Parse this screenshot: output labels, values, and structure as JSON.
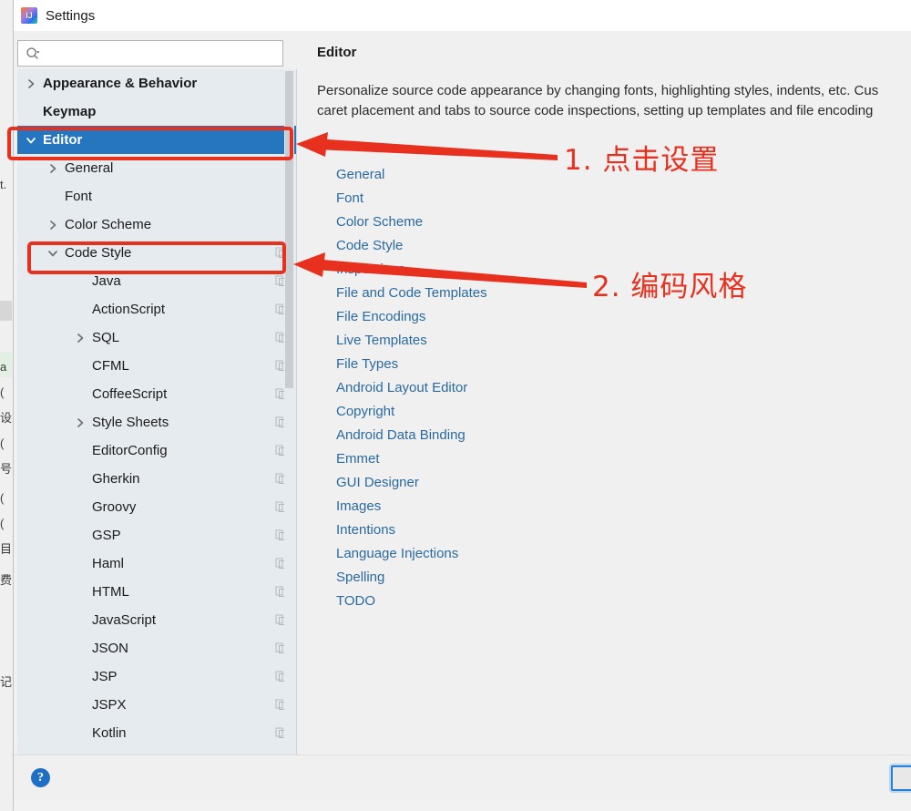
{
  "window": {
    "title": "Settings",
    "icon": "intellij-idea-icon"
  },
  "search": {
    "value": "",
    "placeholder": "",
    "icon": "search-icon"
  },
  "sidebar": {
    "scrollbar": "vertical-scrollbar",
    "items": [
      {
        "label": "Appearance & Behavior",
        "level": 0,
        "twisty": "chevron-right",
        "bold": true,
        "selected": false,
        "copy": false
      },
      {
        "label": "Keymap",
        "level": 0,
        "twisty": "none",
        "bold": true,
        "selected": false,
        "copy": false
      },
      {
        "label": "Editor",
        "level": 0,
        "twisty": "chevron-down",
        "bold": true,
        "selected": true,
        "copy": false
      },
      {
        "label": "General",
        "level": 1,
        "twisty": "chevron-right",
        "bold": false,
        "selected": false,
        "copy": false
      },
      {
        "label": "Font",
        "level": 1,
        "twisty": "none",
        "bold": false,
        "selected": false,
        "copy": false
      },
      {
        "label": "Color Scheme",
        "level": 1,
        "twisty": "chevron-right",
        "bold": false,
        "selected": false,
        "copy": false
      },
      {
        "label": "Code Style",
        "level": 1,
        "twisty": "chevron-down",
        "bold": false,
        "selected": false,
        "copy": true
      },
      {
        "label": "Java",
        "level": 2,
        "twisty": "none",
        "bold": false,
        "selected": false,
        "copy": true
      },
      {
        "label": "ActionScript",
        "level": 2,
        "twisty": "none",
        "bold": false,
        "selected": false,
        "copy": true
      },
      {
        "label": "SQL",
        "level": 2,
        "twisty": "chevron-right",
        "bold": false,
        "selected": false,
        "copy": true
      },
      {
        "label": "CFML",
        "level": 2,
        "twisty": "none",
        "bold": false,
        "selected": false,
        "copy": true
      },
      {
        "label": "CoffeeScript",
        "level": 2,
        "twisty": "none",
        "bold": false,
        "selected": false,
        "copy": true
      },
      {
        "label": "Style Sheets",
        "level": 2,
        "twisty": "chevron-right",
        "bold": false,
        "selected": false,
        "copy": true
      },
      {
        "label": "EditorConfig",
        "level": 2,
        "twisty": "none",
        "bold": false,
        "selected": false,
        "copy": true
      },
      {
        "label": "Gherkin",
        "level": 2,
        "twisty": "none",
        "bold": false,
        "selected": false,
        "copy": true
      },
      {
        "label": "Groovy",
        "level": 2,
        "twisty": "none",
        "bold": false,
        "selected": false,
        "copy": true
      },
      {
        "label": "GSP",
        "level": 2,
        "twisty": "none",
        "bold": false,
        "selected": false,
        "copy": true
      },
      {
        "label": "Haml",
        "level": 2,
        "twisty": "none",
        "bold": false,
        "selected": false,
        "copy": true
      },
      {
        "label": "HTML",
        "level": 2,
        "twisty": "none",
        "bold": false,
        "selected": false,
        "copy": true
      },
      {
        "label": "JavaScript",
        "level": 2,
        "twisty": "none",
        "bold": false,
        "selected": false,
        "copy": true
      },
      {
        "label": "JSON",
        "level": 2,
        "twisty": "none",
        "bold": false,
        "selected": false,
        "copy": true
      },
      {
        "label": "JSP",
        "level": 2,
        "twisty": "none",
        "bold": false,
        "selected": false,
        "copy": true
      },
      {
        "label": "JSPX",
        "level": 2,
        "twisty": "none",
        "bold": false,
        "selected": false,
        "copy": true
      },
      {
        "label": "Kotlin",
        "level": 2,
        "twisty": "none",
        "bold": false,
        "selected": false,
        "copy": true
      }
    ]
  },
  "content": {
    "title": "Editor",
    "description": "Personalize source code appearance by changing fonts, highlighting styles, indents, etc. Cus\ncaret placement and tabs to source code inspections, setting up templates and file encoding",
    "links": [
      "General",
      "Font",
      "Color Scheme",
      "Code Style",
      "Inspections",
      "File and Code Templates",
      "File Encodings",
      "Live Templates",
      "File Types",
      "Android Layout Editor",
      "Copyright",
      "Android Data Binding",
      "Emmet",
      "GUI Designer",
      "Images",
      "Intentions",
      "Language Injections",
      "Spelling",
      "TODO"
    ]
  },
  "bottom": {
    "help_label": "?",
    "ok_label": ""
  },
  "annotations": [
    {
      "text": "1. 点击设置",
      "target": "editor-tree-row"
    },
    {
      "text": "2. 编码风格",
      "target": "code-style-tree-row"
    }
  ],
  "colors": {
    "accent_selection": "#2675bf",
    "link": "#2b6a9e",
    "annotation_red": "#e8301e",
    "sidebar_bg": "#e6ebf0",
    "panel_bg": "#f0f0f0"
  },
  "background_fragments": [
    "t.",
    "a",
    "(",
    "设",
    "(",
    "号",
    "(",
    "(",
    "目",
    "费",
    "记"
  ]
}
